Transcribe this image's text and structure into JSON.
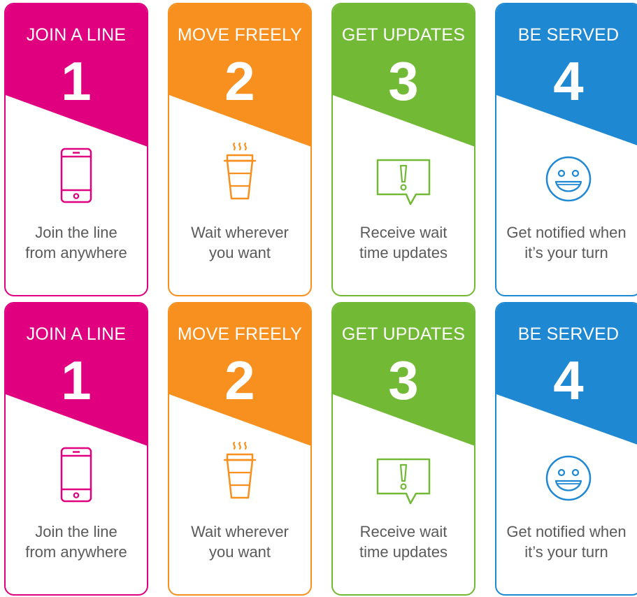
{
  "rows": [
    {
      "cards": [
        {
          "title": "JOIN A LINE",
          "number": "1",
          "line1": "Join the line",
          "line2": "from anywhere",
          "icon": "smartphone-icon",
          "color": "#e0007f"
        },
        {
          "title": "MOVE FREELY",
          "number": "2",
          "line1": "Wait wherever",
          "line2": "you want",
          "icon": "coffee-cup-icon",
          "color": "#f7901e"
        },
        {
          "title": "GET UPDATES",
          "number": "3",
          "line1": "Receive wait",
          "line2": "time updates",
          "icon": "alert-message-icon",
          "color": "#72b936"
        },
        {
          "title": "BE SERVED",
          "number": "4",
          "line1": "Get notified when",
          "line2": "it’s your turn",
          "icon": "smiley-icon",
          "color": "#1e88d2"
        }
      ]
    },
    {
      "cards": [
        {
          "title": "JOIN A LINE",
          "number": "1",
          "line1": "Join the line",
          "line2": "from anywhere",
          "icon": "smartphone-icon",
          "color": "#e0007f"
        },
        {
          "title": "MOVE FREELY",
          "number": "2",
          "line1": "Wait wherever",
          "line2": "you want",
          "icon": "coffee-cup-icon",
          "color": "#f7901e"
        },
        {
          "title": "GET UPDATES",
          "number": "3",
          "line1": "Receive wait",
          "line2": "time updates",
          "icon": "alert-message-icon",
          "color": "#72b936"
        },
        {
          "title": "BE SERVED",
          "number": "4",
          "line1": "Get notified when",
          "line2": "it’s your turn",
          "icon": "smiley-icon",
          "color": "#1e88d2"
        }
      ]
    }
  ]
}
